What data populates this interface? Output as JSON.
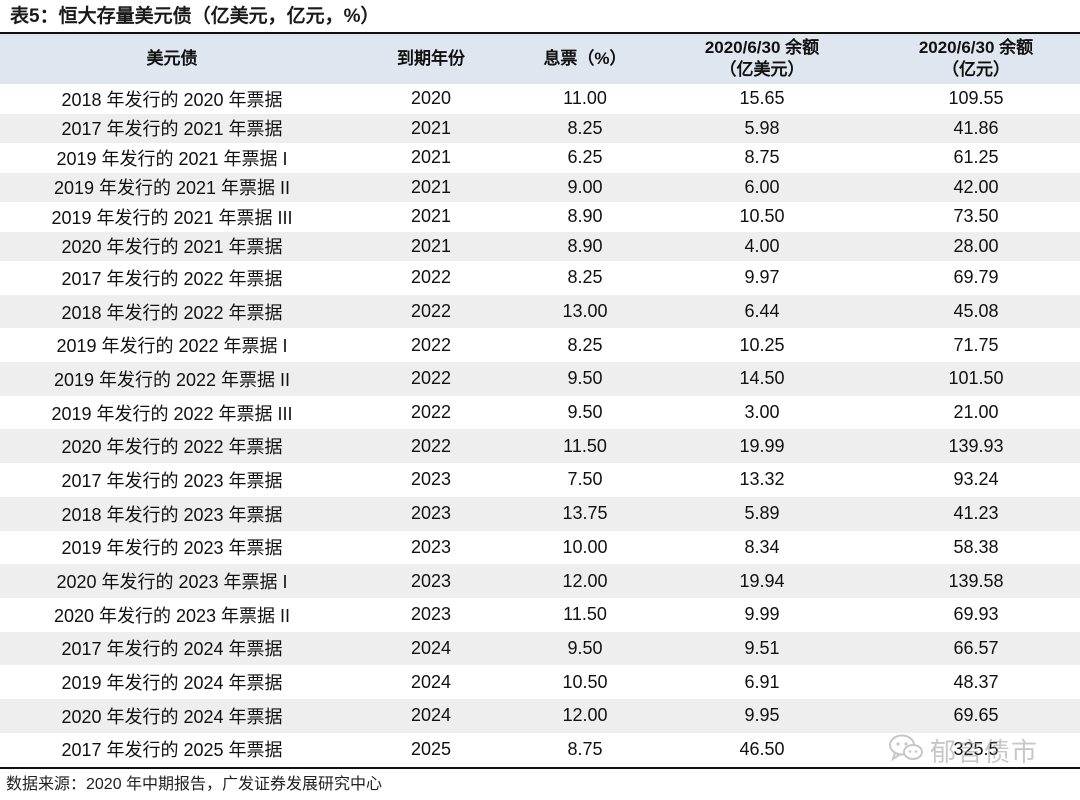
{
  "title": "表5：恒大存量美元债（亿美元，亿元，%）",
  "table": {
    "headers": {
      "bond": "美元债",
      "maturity_year": "到期年份",
      "coupon": "息票（%）",
      "balance_usd_line1": "2020/6/30 余额",
      "balance_usd_line2": "（亿美元）",
      "balance_cny_line1": "2020/6/30 余额",
      "balance_cny_line2": "（亿元）"
    },
    "rows": [
      {
        "bond": "2018 年发行的 2020 年票据",
        "maturity": "2020",
        "coupon": "11.00",
        "usd": "15.65",
        "cny": "109.55"
      },
      {
        "bond": "2017 年发行的 2021 年票据",
        "maturity": "2021",
        "coupon": "8.25",
        "usd": "5.98",
        "cny": "41.86"
      },
      {
        "bond": "2019 年发行的 2021 年票据 I",
        "maturity": "2021",
        "coupon": "6.25",
        "usd": "8.75",
        "cny": "61.25"
      },
      {
        "bond": "2019 年发行的 2021 年票据 II",
        "maturity": "2021",
        "coupon": "9.00",
        "usd": "6.00",
        "cny": "42.00"
      },
      {
        "bond": "2019 年发行的 2021 年票据 III",
        "maturity": "2021",
        "coupon": "8.90",
        "usd": "10.50",
        "cny": "73.50"
      },
      {
        "bond": "2020 年发行的 2021 年票据",
        "maturity": "2021",
        "coupon": "8.90",
        "usd": "4.00",
        "cny": "28.00"
      },
      {
        "bond": "2017 年发行的 2022 年票据",
        "maturity": "2022",
        "coupon": "8.25",
        "usd": "9.97",
        "cny": "69.79"
      },
      {
        "bond": "2018 年发行的 2022 年票据",
        "maturity": "2022",
        "coupon": "13.00",
        "usd": "6.44",
        "cny": "45.08"
      },
      {
        "bond": "2019 年发行的 2022 年票据 I",
        "maturity": "2022",
        "coupon": "8.25",
        "usd": "10.25",
        "cny": "71.75"
      },
      {
        "bond": "2019 年发行的 2022 年票据 II",
        "maturity": "2022",
        "coupon": "9.50",
        "usd": "14.50",
        "cny": "101.50"
      },
      {
        "bond": "2019 年发行的 2022 年票据 III",
        "maturity": "2022",
        "coupon": "9.50",
        "usd": "3.00",
        "cny": "21.00"
      },
      {
        "bond": "2020 年发行的 2022 年票据",
        "maturity": "2022",
        "coupon": "11.50",
        "usd": "19.99",
        "cny": "139.93"
      },
      {
        "bond": "2017 年发行的 2023 年票据",
        "maturity": "2023",
        "coupon": "7.50",
        "usd": "13.32",
        "cny": "93.24"
      },
      {
        "bond": "2018 年发行的 2023 年票据",
        "maturity": "2023",
        "coupon": "13.75",
        "usd": "5.89",
        "cny": "41.23"
      },
      {
        "bond": "2019 年发行的 2023 年票据",
        "maturity": "2023",
        "coupon": "10.00",
        "usd": "8.34",
        "cny": "58.38"
      },
      {
        "bond": "2020 年发行的 2023 年票据 I",
        "maturity": "2023",
        "coupon": "12.00",
        "usd": "19.94",
        "cny": "139.58"
      },
      {
        "bond": "2020 年发行的 2023 年票据 II",
        "maturity": "2023",
        "coupon": "11.50",
        "usd": "9.99",
        "cny": "69.93"
      },
      {
        "bond": "2017 年发行的 2024 年票据",
        "maturity": "2024",
        "coupon": "9.50",
        "usd": "9.51",
        "cny": "66.57"
      },
      {
        "bond": "2019 年发行的 2024 年票据",
        "maturity": "2024",
        "coupon": "10.50",
        "usd": "6.91",
        "cny": "48.37"
      },
      {
        "bond": "2020 年发行的 2024 年票据",
        "maturity": "2024",
        "coupon": "12.00",
        "usd": "9.95",
        "cny": "69.65"
      },
      {
        "bond": "2017 年发行的 2025 年票据",
        "maturity": "2025",
        "coupon": "8.75",
        "usd": "46.50",
        "cny": "325.5"
      }
    ]
  },
  "source": "数据来源：2020 年中期报告，广发证券发展研究中心",
  "watermark": {
    "icon": "wechat-icon",
    "text": "郁言债市"
  }
}
